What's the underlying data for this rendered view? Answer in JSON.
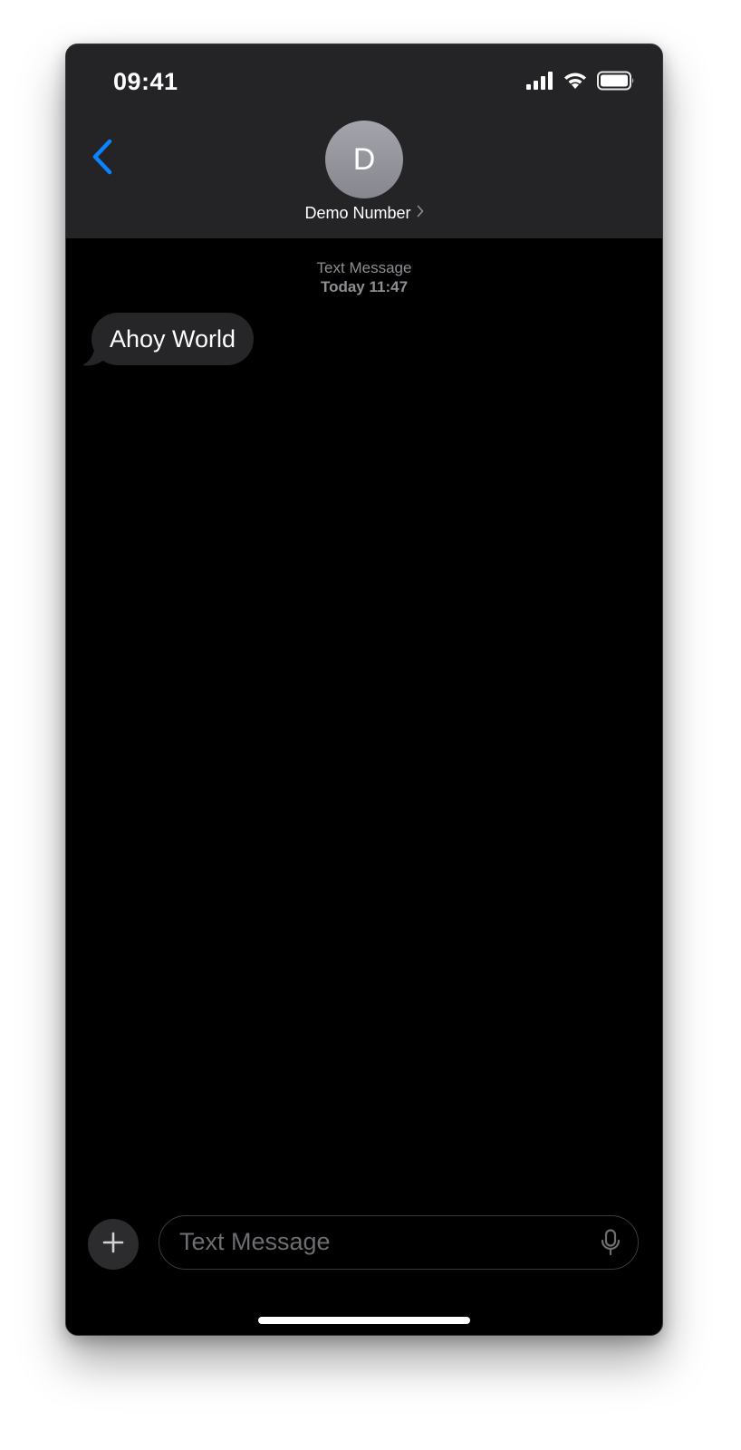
{
  "status_bar": {
    "time": "09:41",
    "icons": [
      "cellular-signal-icon",
      "wifi-icon",
      "battery-icon"
    ]
  },
  "header": {
    "back_icon": "chevron-left-icon",
    "avatar_initial": "D",
    "contact_name": "Demo Number",
    "contact_chevron_icon": "chevron-right-icon"
  },
  "conversation": {
    "service_label": "Text Message",
    "timestamp": "Today 11:47",
    "messages": [
      {
        "direction": "incoming",
        "text": "Ahoy World"
      }
    ]
  },
  "composer": {
    "add_icon": "plus-icon",
    "placeholder": "Text Message",
    "value": "",
    "mic_icon": "microphone-icon"
  },
  "colors": {
    "accent": "#0a84ff",
    "header_bg": "#242426",
    "screen_bg": "#000000",
    "incoming_bubble": "#262628",
    "secondary_text": "#8e8e93"
  }
}
